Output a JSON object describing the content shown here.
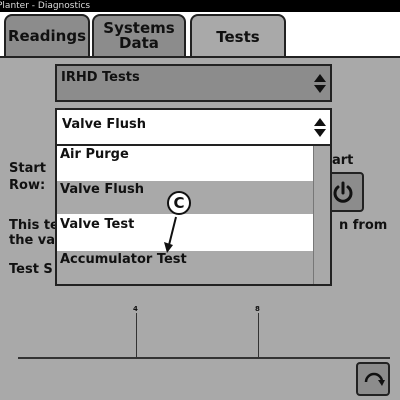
{
  "window": {
    "title": "Planter - Diagnostics"
  },
  "tabs": [
    {
      "label": "Readings"
    },
    {
      "label": "Systems\nData"
    },
    {
      "label": "Tests"
    }
  ],
  "test_category": {
    "value": "IRHD Tests"
  },
  "test_select": {
    "value": "Valve Flush"
  },
  "options": [
    "Air Purge",
    "Valve Flush",
    "Valve Test",
    "Accumulator Test"
  ],
  "labels": {
    "start_row": "Start\nRow:",
    "start_right": "art",
    "this_test": "This te\nthe val",
    "n_from": "n from",
    "test_status": "Test S"
  },
  "callout": {
    "letter": "C"
  },
  "axis": {
    "ticks": [
      "4",
      "8"
    ]
  },
  "icons": {
    "start": "power-icon",
    "reset": "refresh-icon",
    "dropdown": "up-down-arrows-icon"
  },
  "colors": {
    "panel": "#a9a9a9",
    "tab": "#8c8c8c",
    "border": "#222222"
  }
}
